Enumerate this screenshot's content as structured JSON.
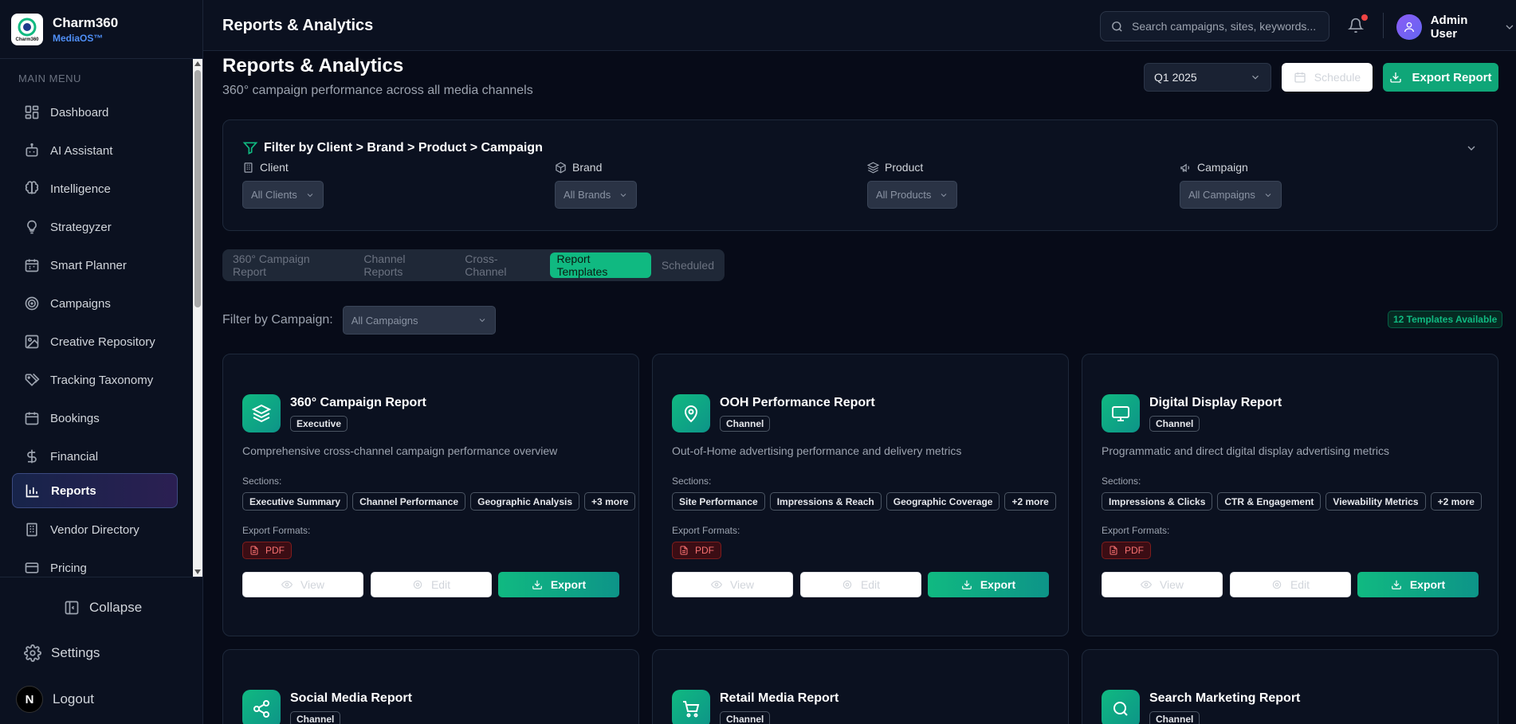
{
  "brand": {
    "name": "Charm360",
    "sub": "MediaOS™",
    "logo_text": "Charm360"
  },
  "sidebar": {
    "heading": "MAIN MENU",
    "items": [
      {
        "label": "Dashboard",
        "icon": "dashboard-icon"
      },
      {
        "label": "AI Assistant",
        "icon": "bot-icon"
      },
      {
        "label": "Intelligence",
        "icon": "brain-icon"
      },
      {
        "label": "Strategyzer",
        "icon": "lightbulb-icon"
      },
      {
        "label": "Smart Planner",
        "icon": "calendar-icon"
      },
      {
        "label": "Campaigns",
        "icon": "target-icon"
      },
      {
        "label": "Creative Repository",
        "icon": "image-icon"
      },
      {
        "label": "Tracking Taxonomy",
        "icon": "tags-icon"
      },
      {
        "label": "Bookings",
        "icon": "calendar-icon"
      },
      {
        "label": "Financial",
        "icon": "dollar-icon"
      },
      {
        "label": "Reports",
        "icon": "bar-chart-icon",
        "active": true
      },
      {
        "label": "Vendor Directory",
        "icon": "building-icon"
      },
      {
        "label": "Pricing",
        "icon": "credit-card-icon"
      }
    ],
    "collapse_label": "Collapse",
    "settings_label": "Settings",
    "logout_label": "Logout",
    "logout_avatar": "N"
  },
  "topbar": {
    "title": "Reports & Analytics",
    "search_placeholder": "Search campaigns, sites, keywords...",
    "user_name": "Admin User"
  },
  "page": {
    "title": "Reports & Analytics",
    "subtitle": "360° campaign performance across all media channels",
    "period": "Q1 2025",
    "schedule_label": "Schedule",
    "export_label": "Export Report"
  },
  "filters": {
    "title": "Filter by Client > Brand > Product > Campaign",
    "fields": [
      {
        "label": "Client",
        "value": "All Clients"
      },
      {
        "label": "Brand",
        "value": "All Brands"
      },
      {
        "label": "Product",
        "value": "All Products"
      },
      {
        "label": "Campaign",
        "value": "All Campaigns"
      }
    ]
  },
  "tabs": [
    {
      "label": "360° Campaign Report"
    },
    {
      "label": "Channel Reports"
    },
    {
      "label": "Cross-Channel"
    },
    {
      "label": "Report Templates",
      "active": true
    },
    {
      "label": "Scheduled"
    }
  ],
  "campaign_filter": {
    "label": "Filter by Campaign:",
    "value": "All Campaigns"
  },
  "templates_count": "12 Templates Available",
  "card_labels": {
    "sections": "Sections:",
    "formats": "Export Formats:",
    "view": "View",
    "edit": "Edit",
    "export": "Export"
  },
  "cards": [
    {
      "title": "360° Campaign Report",
      "tag": "Executive",
      "icon": "layers-icon",
      "description": "Comprehensive cross-channel campaign performance overview",
      "sections": [
        "Executive Summary",
        "Channel Performance",
        "Geographic Analysis",
        "+3 more"
      ],
      "format": "PDF"
    },
    {
      "title": "OOH Performance Report",
      "tag": "Channel",
      "icon": "map-pin-icon",
      "description": "Out-of-Home advertising performance and delivery metrics",
      "sections": [
        "Site Performance",
        "Impressions & Reach",
        "Geographic Coverage",
        "+2 more"
      ],
      "format": "PDF"
    },
    {
      "title": "Digital Display Report",
      "tag": "Channel",
      "icon": "monitor-icon",
      "description": "Programmatic and direct digital display advertising metrics",
      "sections": [
        "Impressions & Clicks",
        "CTR & Engagement",
        "Viewability Metrics",
        "+2 more"
      ],
      "format": "PDF"
    },
    {
      "title": "Social Media Report",
      "tag": "Channel",
      "icon": "share-icon"
    },
    {
      "title": "Retail Media Report",
      "tag": "Channel",
      "icon": "cart-icon"
    },
    {
      "title": "Search Marketing Report",
      "tag": "Channel",
      "icon": "search-icon"
    }
  ],
  "colors": {
    "accent": "#10b981",
    "background": "#070b18",
    "panel": "#0b1120",
    "pdf": "#f87171",
    "active_nav": "#2b1f52"
  }
}
